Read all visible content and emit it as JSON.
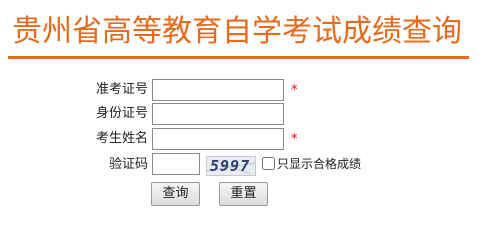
{
  "header": {
    "title": "贵州省高等教育自学考试成绩查询"
  },
  "form": {
    "exam_id_label": "准考证号",
    "exam_id_value": "",
    "id_card_label": "身份证号",
    "id_card_value": "",
    "name_label": "考生姓名",
    "name_value": "",
    "captcha_label": "验证码",
    "captcha_value": "",
    "captcha_image_text": "5997",
    "required_mark": "*",
    "passed_only_label": "只显示合格成绩",
    "passed_only_checked": false
  },
  "actions": {
    "query_label": "查询",
    "reset_label": "重置"
  },
  "colors": {
    "title": "#E86A1C",
    "required": "#FF0000"
  }
}
